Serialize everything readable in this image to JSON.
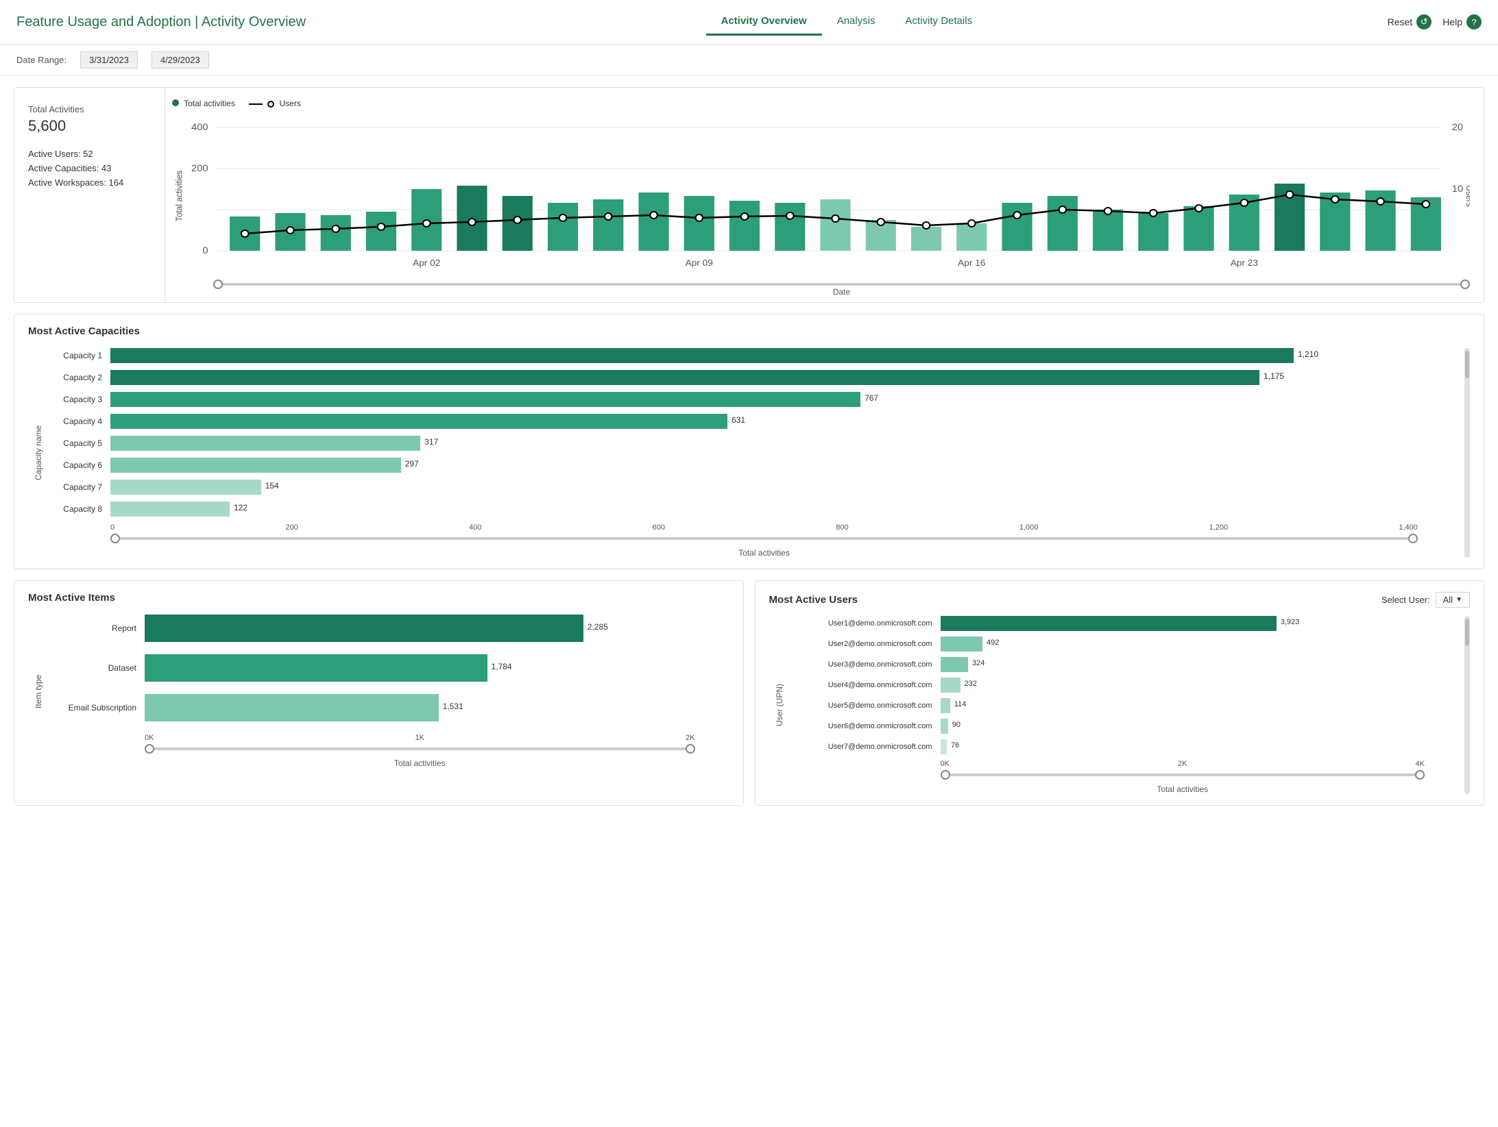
{
  "header": {
    "title": "Feature Usage and Adoption | Activity Overview",
    "nav": [
      {
        "id": "activity-overview",
        "label": "Activity Overview",
        "active": true
      },
      {
        "id": "analysis",
        "label": "Analysis",
        "active": false
      },
      {
        "id": "activity-details",
        "label": "Activity Details",
        "active": false
      }
    ],
    "reset_label": "Reset",
    "help_label": "Help"
  },
  "toolbar": {
    "date_range_label": "Date Range:",
    "date_start": "3/31/2023",
    "date_end": "4/29/2023"
  },
  "stats": {
    "total_activities_label": "Total Activities",
    "total_activities_value": "5,600",
    "active_users_label": "Active Users: 52",
    "active_capacities_label": "Active Capacities: 43",
    "active_workspaces_label": "Active Workspaces: 164"
  },
  "top_chart": {
    "legend_activities": "Total activities",
    "legend_users": "Users",
    "x_axis_label": "Date",
    "y_axis_left": "Total activities",
    "y_axis_right": "Users",
    "dates": [
      "Apr 02",
      "Apr 09",
      "Apr 16",
      "Apr 23"
    ],
    "y_ticks_left": [
      0,
      200,
      400
    ],
    "y_ticks_right": [
      10,
      20
    ]
  },
  "capacity_chart": {
    "title": "Most Active Capacities",
    "y_axis_label": "Capacity name",
    "x_axis_label": "Total activities",
    "x_ticks": [
      "0",
      "200",
      "400",
      "600",
      "800",
      "1,000",
      "1,200",
      "1,400"
    ],
    "max_value": 1400,
    "bars": [
      {
        "label": "Capacity 1",
        "value": 1210,
        "color": "#1a7a5e"
      },
      {
        "label": "Capacity 2",
        "value": 1175,
        "color": "#1a7a5e"
      },
      {
        "label": "Capacity 3",
        "value": 767,
        "color": "#2d9e7a"
      },
      {
        "label": "Capacity 4",
        "value": 631,
        "color": "#2d9e7a"
      },
      {
        "label": "Capacity 5",
        "value": 317,
        "color": "#7ec8b0"
      },
      {
        "label": "Capacity 6",
        "value": 297,
        "color": "#7ec8b0"
      },
      {
        "label": "Capacity 7",
        "value": 154,
        "color": "#a8d8c8"
      },
      {
        "label": "Capacity 8",
        "value": 122,
        "color": "#a8d8c8"
      }
    ]
  },
  "items_chart": {
    "title": "Most Active Items",
    "y_axis_label": "Item type",
    "x_axis_label": "Total activities",
    "x_ticks": [
      "0K",
      "1K",
      "2K"
    ],
    "max_value": 2500,
    "bars": [
      {
        "label": "Report",
        "value": 2285,
        "color": "#1a7a5e"
      },
      {
        "label": "Dataset",
        "value": 1784,
        "color": "#2d9e7a"
      },
      {
        "label": "Email Subscription",
        "value": 1531,
        "color": "#7ec8b0"
      }
    ]
  },
  "users_chart": {
    "title": "Most Active Users",
    "select_label": "Select User:",
    "select_value": "All",
    "y_axis_label": "User (UPN)",
    "x_axis_label": "Total activities",
    "x_ticks": [
      "0K",
      "2K",
      "4K"
    ],
    "max_value": 4000,
    "bars": [
      {
        "label": "User1@demo.onmicrosoft.com",
        "value": 3923,
        "color": "#1a7a5e"
      },
      {
        "label": "User2@demo.onmicrosoft.com",
        "value": 492,
        "color": "#7ec8b0"
      },
      {
        "label": "User3@demo.onmicrosoft.com",
        "value": 324,
        "color": "#7ec8b0"
      },
      {
        "label": "User4@demo.onmicrosoft.com",
        "value": 232,
        "color": "#a8d8c8"
      },
      {
        "label": "User5@demo.onmicrosoft.com",
        "value": 114,
        "color": "#a8d8c8"
      },
      {
        "label": "User6@demo.onmicrosoft.com",
        "value": 90,
        "color": "#a8d8c8"
      },
      {
        "label": "User7@demo.onmicrosoft.com",
        "value": 76,
        "color": "#c5e8de"
      }
    ]
  }
}
